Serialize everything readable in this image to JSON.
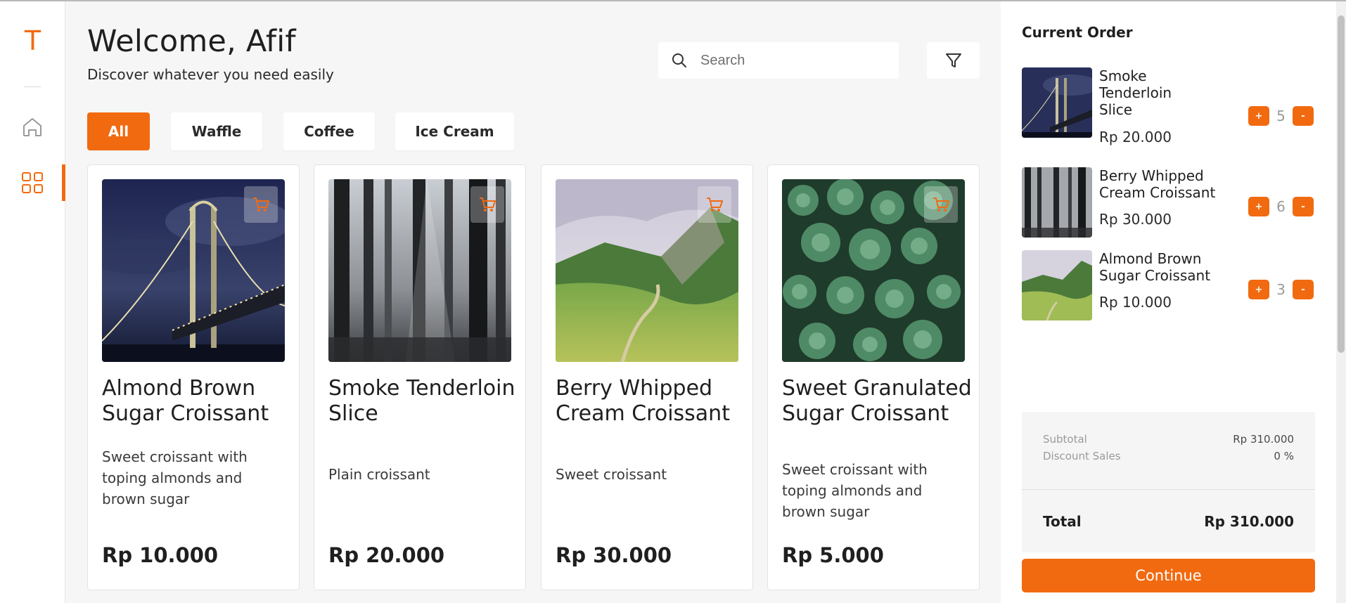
{
  "brand": {
    "logo_letter": "T",
    "accent": "#F26A10"
  },
  "sidebar": {
    "items": [
      {
        "name": "home",
        "icon": "home-icon",
        "active": false
      },
      {
        "name": "menu",
        "icon": "grid-icon",
        "active": true
      }
    ]
  },
  "header": {
    "welcome": "Welcome, Afif",
    "subtitle": "Discover whatever you need easily",
    "search_placeholder": "Search",
    "search_icon": "search-icon",
    "filter_icon": "filter-icon"
  },
  "categories": [
    {
      "label": "All",
      "active": true
    },
    {
      "label": "Waffle",
      "active": false
    },
    {
      "label": "Coffee",
      "active": false
    },
    {
      "label": "Ice Cream",
      "active": false
    }
  ],
  "products": [
    {
      "title": "Almond Brown Sugar Croissant",
      "description": "Sweet croissant with toping almonds and brown sugar",
      "price": "Rp 10.000",
      "image": "bridge-night"
    },
    {
      "title": "Smoke Tenderloin Slice",
      "description": "Plain croissant",
      "price": "Rp 20.000",
      "image": "forest"
    },
    {
      "title": "Berry Whipped Cream Croissant",
      "description": "Sweet croissant",
      "price": "Rp 30.000",
      "image": "mountain"
    },
    {
      "title": "Sweet Granulated Sugar Croissant",
      "description": "Sweet croissant with toping almonds and brown sugar",
      "price": "Rp 5.000",
      "image": "succulents"
    }
  ],
  "order": {
    "heading": "Current Order",
    "items": [
      {
        "name": "Smoke Tenderloin Slice",
        "price": "Rp 20.000",
        "qty": "5",
        "image": "bridge-night"
      },
      {
        "name": "Berry Whipped Cream Croissant",
        "price": "Rp 30.000",
        "qty": "6",
        "image": "forest"
      },
      {
        "name": "Almond Brown Sugar Croissant",
        "price": "Rp 10.000",
        "qty": "3",
        "image": "mountain"
      }
    ],
    "plus_label": "+",
    "minus_label": "-",
    "subtotal_label": "Subtotal",
    "subtotal_value": "Rp 310.000",
    "discount_label": "Discount Sales",
    "discount_value": "0 %",
    "total_label": "Total",
    "total_value": "Rp 310.000",
    "continue_label": "Continue"
  }
}
